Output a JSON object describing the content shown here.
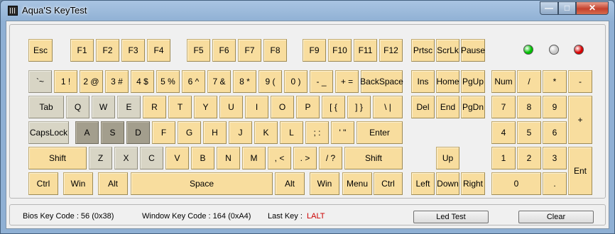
{
  "window": {
    "title": "Aqua'S KeyTest"
  },
  "titlebar": {
    "minimize": "—",
    "maximize": "□",
    "close": "✕"
  },
  "colors": {
    "key_idle": "#f8dd9e",
    "key_pressed": "#d8d5c5",
    "key_held": "#a39e8d",
    "last_key": "#cc0000"
  },
  "leds": [
    {
      "name": "led-green",
      "color": "#00c000"
    },
    {
      "name": "led-gray",
      "color": "#c8c8c8"
    },
    {
      "name": "led-red",
      "color": "#d80000"
    }
  ],
  "keys": {
    "esc": "Esc",
    "f1": "F1",
    "f2": "F2",
    "f3": "F3",
    "f4": "F4",
    "f5": "F5",
    "f6": "F6",
    "f7": "F7",
    "f8": "F8",
    "f9": "F9",
    "f10": "F10",
    "f11": "F11",
    "f12": "F12",
    "prtsc": "Prtsc",
    "scrlk": "ScrLk",
    "pause": "Pause",
    "backtick": "`~",
    "k1": "1 !",
    "k2": "2 @",
    "k3": "3 #",
    "k4": "4 $",
    "k5": "5 %",
    "k6": "6 ^",
    "k7": "7 &",
    "k8": "8 *",
    "k9": "9 (",
    "k0": "0 )",
    "minus": "- _",
    "equals": "+ =",
    "backspace": "BackSpace",
    "ins": "Ins",
    "home": "Home",
    "pgup": "PgUp",
    "num": "Num",
    "np_div": "/",
    "np_mul": "*",
    "np_sub": "-",
    "tab": "Tab",
    "q": "Q",
    "w": "W",
    "e": "E",
    "r": "R",
    "t": "T",
    "y": "Y",
    "u": "U",
    "i": "I",
    "o": "O",
    "p": "P",
    "lbracket": "[ {",
    "rbracket": "] }",
    "backslash": "\\ |",
    "del": "Del",
    "end": "End",
    "pgdn": "PgDn",
    "np7": "7",
    "np8": "8",
    "np9": "9",
    "np_add": "+",
    "capslock": "CapsLock",
    "a": "A",
    "s": "S",
    "d": "D",
    "f": "F",
    "g": "G",
    "h": "H",
    "j": "J",
    "k": "K",
    "l": "L",
    "semicolon": "; :",
    "quote": "' \"",
    "enter": "Enter",
    "np4": "4",
    "np5": "5",
    "np6": "6",
    "lshift": "Shift",
    "z": "Z",
    "x": "X",
    "c": "C",
    "v": "V",
    "b": "B",
    "n": "N",
    "m": "M",
    "comma": ", <",
    "period": ". >",
    "slash": "/ ?",
    "rshift": "Shift",
    "up": "Up",
    "np1": "1",
    "np2": "2",
    "np3": "3",
    "np_enter": "Ent",
    "lctrl": "Ctrl",
    "lwin": "Win",
    "lalt": "Alt",
    "space": "Space",
    "ralt": "Alt",
    "rwin": "Win",
    "menu": "Menu",
    "rctrl": "Ctrl",
    "left": "Left",
    "down": "Down",
    "right": "Right",
    "np0": "0",
    "np_dot": "."
  },
  "status": {
    "bios_key_code": "Bios Key Code : 56 (0x38)",
    "window_key_code": "Window Key Code : 164 (0xA4)",
    "last_key_label": "Last Key :",
    "last_key_value": "LALT",
    "led_test_button": "Led Test",
    "clear_button": "Clear"
  }
}
